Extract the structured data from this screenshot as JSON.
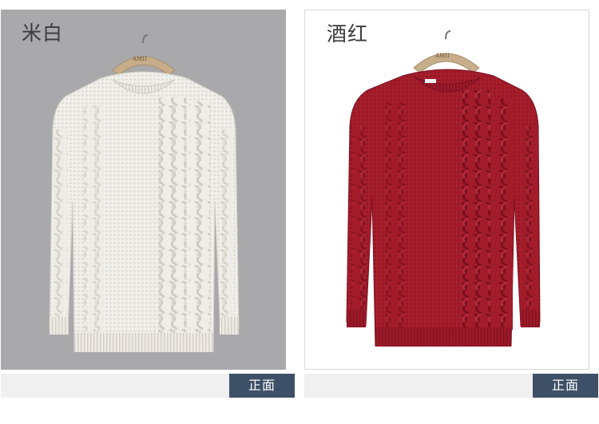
{
  "products": [
    {
      "color_label": "米白",
      "hanger_brand": "AMII",
      "sweater_color": "#f1efea",
      "background": "#a9a9ab"
    },
    {
      "color_label": "酒红",
      "hanger_brand": "AMII",
      "sweater_color": "#a61d2b",
      "background": "#ffffff"
    }
  ],
  "view_buttons": [
    {
      "label": "正面"
    },
    {
      "label": "正面"
    }
  ],
  "colors": {
    "button_bg": "#3e5068",
    "bar_bg": "#f0f0f0"
  }
}
